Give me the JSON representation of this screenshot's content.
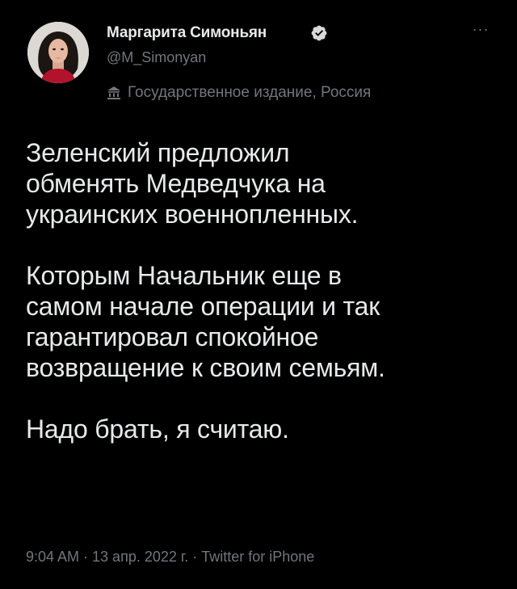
{
  "author": {
    "display_name": "Маргарита Симоньян",
    "handle": "@M_Simonyan",
    "verified": true,
    "affiliation": "Государственное издание, Россия"
  },
  "menu": {
    "more_glyph": "···"
  },
  "tweet": {
    "paragraphs": [
      {
        "lines": [
          "Зеленский предложил",
          "обменять Медведчука на",
          "украинских военнопленных."
        ]
      },
      {
        "lines": [
          "Которым Начальник еще в",
          "самом начале операции и так",
          "гарантировал спокойное",
          "возвращение к своим семьям."
        ]
      },
      {
        "lines": [
          "Надо брать, я считаю."
        ]
      }
    ],
    "timestamp_line": "9:04 AM · 13 апр. 2022 г. · Twitter for iPhone"
  },
  "colors": {
    "background": "#000000",
    "primary_text": "#e7e9ea",
    "secondary_text": "#71767b",
    "verified_badge": "#d7dadc"
  },
  "icons": {
    "verified": "verified-badge-icon",
    "affiliation": "government-building-icon",
    "more": "more-options-icon"
  }
}
